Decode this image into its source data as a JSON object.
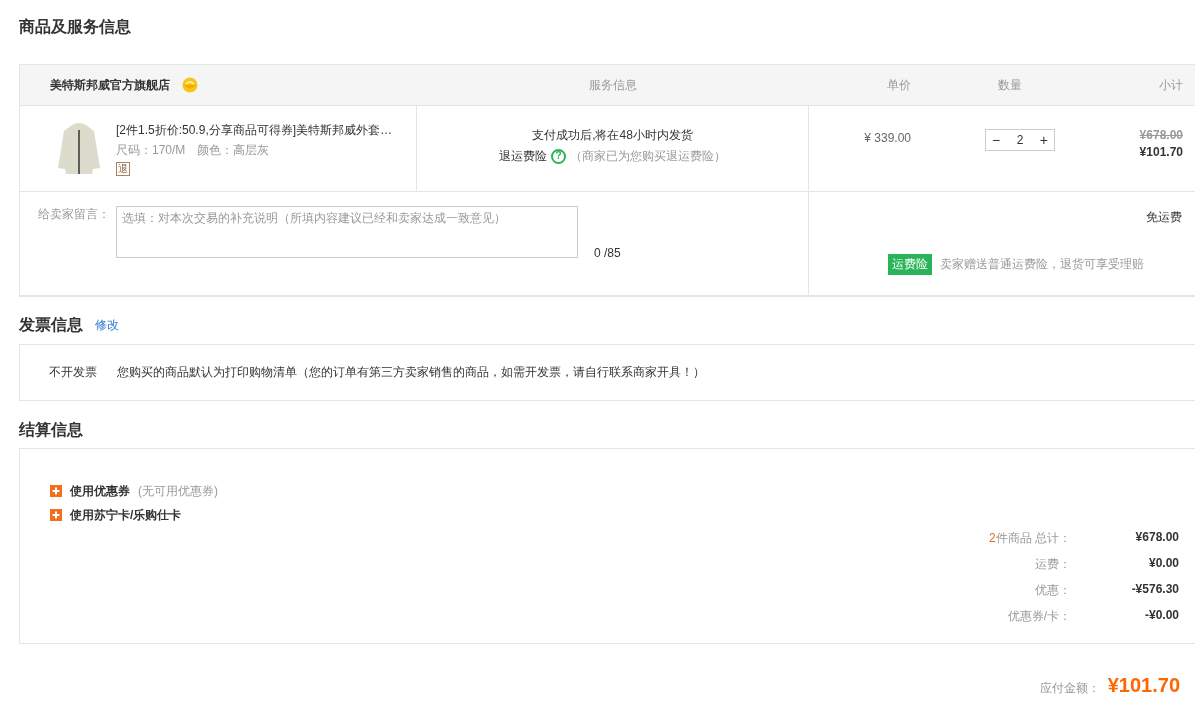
{
  "goods_section": {
    "title": "商品及服务信息",
    "store": {
      "name": "美特斯邦威官方旗舰店"
    },
    "columns": [
      "服务信息",
      "单价",
      "数量",
      "小计"
    ],
    "item": {
      "title": "[2件1.5折价:50.9,分享商品可得券]美特斯邦威外套…",
      "size": "尺码：170/M",
      "color_spec": "颜色：高层灰",
      "return_badge": "退",
      "shipping_note": "支付成功后,将在48小时内发货",
      "insurance_label": "退运费险",
      "help_mark": "?",
      "insurance_note": "（商家已为您购买退运费险）",
      "unit_price": "¥ 339.00",
      "minus": "−",
      "quantity": "2",
      "plus": "+",
      "original_subtotal": "¥678.00",
      "subtotal": "¥101.70"
    },
    "message": {
      "label": "给卖家留言：",
      "placeholder": "选填：对本次交易的补充说明（所填内容建议已经和卖家达成一致意见）",
      "counter": "0 /85"
    },
    "shipping": {
      "fee": "免运费",
      "badge": "运费险",
      "note": "卖家赠送普通运费险，退货可享受理赔"
    }
  },
  "invoice": {
    "title": "发票信息",
    "edit_link": "修改",
    "type": "不开发票",
    "note": "您购买的商品默认为打印购物清单（您的订单有第三方卖家销售的商品，如需开发票，请自行联系商家开具！）"
  },
  "settlement": {
    "title": "结算信息",
    "options": [
      {
        "label": "使用优惠券",
        "note": "(无可用优惠券)"
      },
      {
        "label": "使用苏宁卡/乐购仕卡"
      }
    ],
    "summary": [
      {
        "count": "2",
        "label": "件商品 总计：",
        "value": "¥678.00"
      },
      {
        "label": "运费：",
        "value": "¥0.00"
      },
      {
        "label": "优惠：",
        "value": "-¥576.30"
      },
      {
        "label": "优惠券/卡：",
        "value": "-¥0.00"
      }
    ],
    "total": {
      "label": "应付金额：",
      "value": "¥101.70"
    }
  }
}
